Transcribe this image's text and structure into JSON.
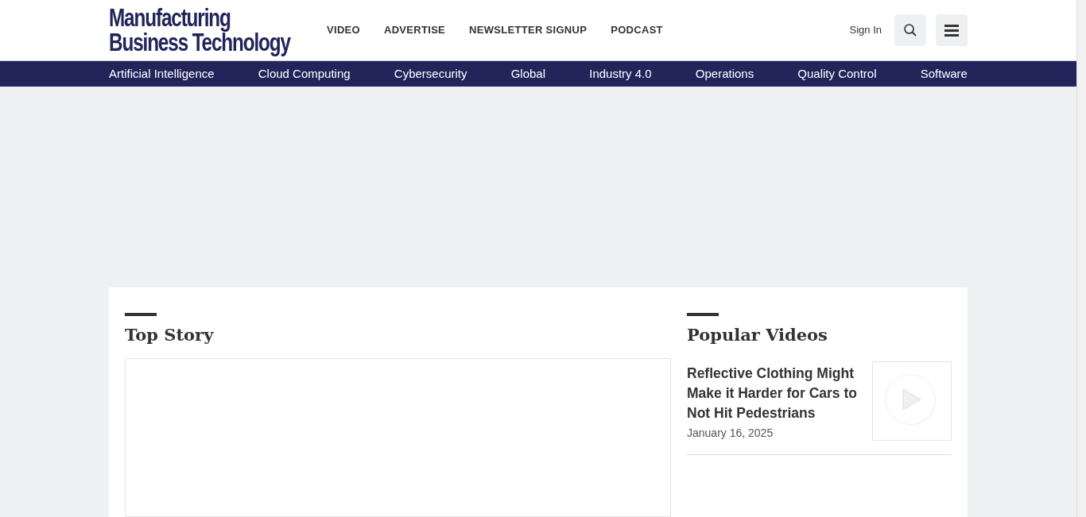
{
  "logo": {
    "line_1": "Manufacturing",
    "line_2": "Business Technology"
  },
  "top_nav": [
    "VIDEO",
    "ADVERTISE",
    "NEWSLETTER SIGNUP",
    "PODCAST"
  ],
  "sign_in": "Sign In",
  "topics": [
    "Artificial Intelligence",
    "Cloud Computing",
    "Cybersecurity",
    "Global",
    "Industry 4.0",
    "Operations",
    "Quality Control",
    "Software"
  ],
  "top_story": {
    "heading": "Top Story"
  },
  "popular_videos": {
    "heading": "Popular Videos",
    "items": [
      {
        "title": "Reflective Clothing Might Make it Harder for Cars to Not Hit Pedestrians",
        "date": "January 16, 2025"
      }
    ]
  }
}
